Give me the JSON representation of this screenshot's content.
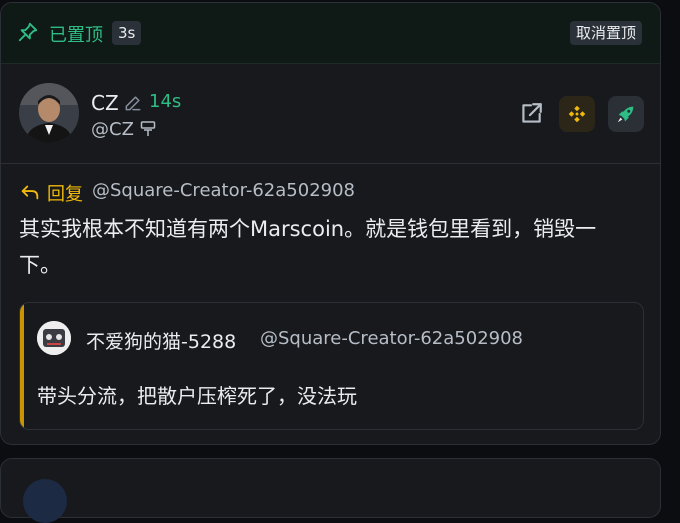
{
  "pinned_bar": {
    "label": "已置顶",
    "age": "3s",
    "unpin_label": "取消置顶",
    "pin_icon": "pin-icon"
  },
  "post": {
    "author": "CZ",
    "age": "14s",
    "handle": "@CZ",
    "reply": {
      "label": "回复",
      "target": "@Square-Creator-62a502908"
    },
    "body": "其实我根本不知道有两个Marscoin。就是钱包里看到，销毁一下。",
    "actions": [
      "share-icon",
      "bnb-logo-icon",
      "rocket-icon"
    ]
  },
  "quote": {
    "author": "不爱狗的猫-5288",
    "handle": "@Square-Creator-62a502908",
    "text": "带头分流，把散户压榨死了，没法玩"
  },
  "colors": {
    "accent_green": "#2ebd85",
    "accent_gold": "#f0b90b",
    "quote_bar": "#c99400",
    "card_bg": "#17191d",
    "page_bg": "#0b0d10"
  }
}
